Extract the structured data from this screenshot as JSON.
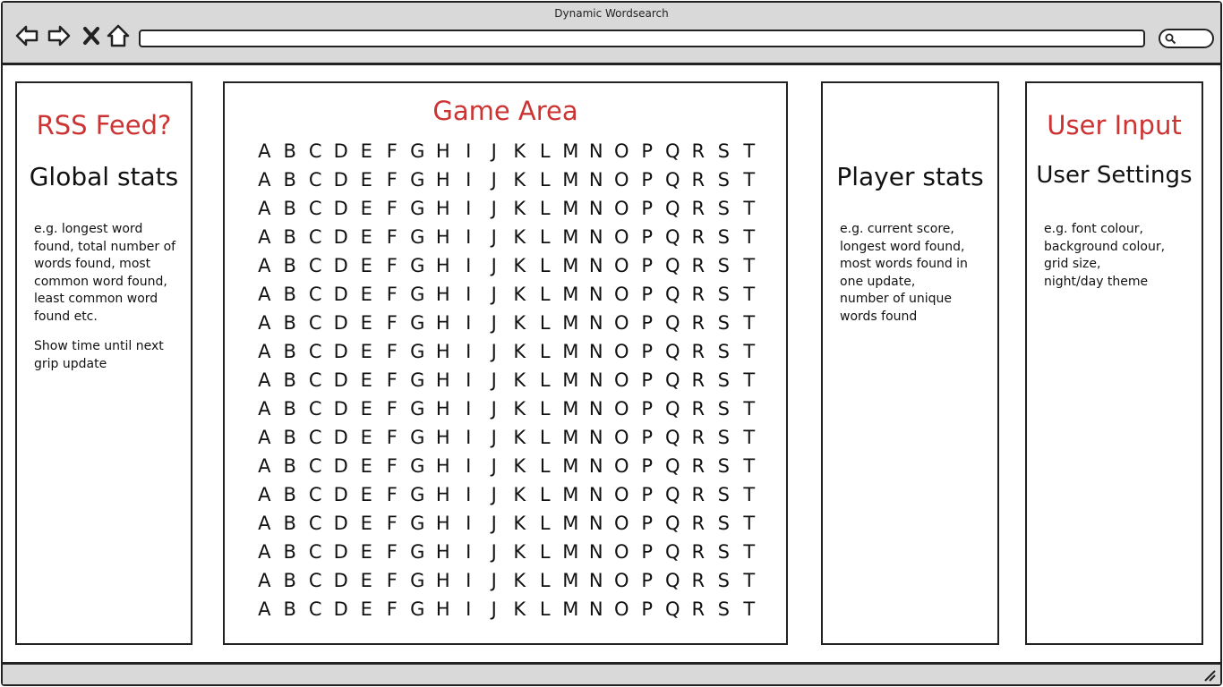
{
  "window": {
    "title": "Dynamic Wordsearch"
  },
  "toolbar": {
    "back_icon": "arrow-left-icon",
    "forward_icon": "arrow-right-icon",
    "close_icon": "close-icon",
    "home_icon": "home-icon",
    "address_value": "",
    "search_icon": "search-icon",
    "search_value": ""
  },
  "left_panel": {
    "heading": "RSS Feed?",
    "subheading": "Global stats",
    "description": "e.g. longest word\nfound, total number of\nwords found, most\ncommon word found,\nleast common word\nfound etc.",
    "note": "Show time until next\ngrip update"
  },
  "game_panel": {
    "heading": "Game Area",
    "letters": [
      "A",
      "B",
      "C",
      "D",
      "E",
      "F",
      "G",
      "H",
      "I",
      "J",
      "K",
      "L",
      "M",
      "N",
      "O",
      "P",
      "Q",
      "R",
      "S",
      "T"
    ],
    "row_count": 17
  },
  "player_panel": {
    "subheading": "Player stats",
    "description": "e.g. current score,\nlongest word found,\nmost words found in\none update,\nnumber of unique\nwords found"
  },
  "user_panel": {
    "heading": "User Input",
    "subheading": "User Settings",
    "description": "e.g. font colour,\nbackground colour,\ngrid size,\nnight/day theme"
  },
  "colors": {
    "accent": "#cc3333",
    "chrome": "#d9d9d9",
    "border": "#222222"
  }
}
